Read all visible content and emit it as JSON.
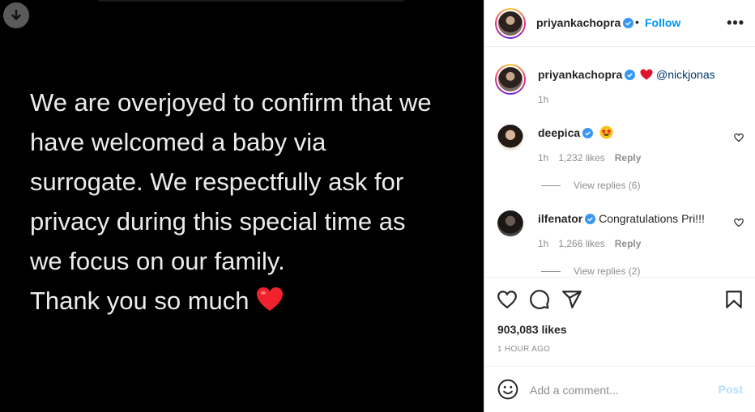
{
  "media": {
    "post_text": "We are overjoyed to confirm that we\nhave welcomed a baby via\nsurrogate. We respectfully ask for\nprivacy during this special time as\nwe focus on our family.\nThank you so much",
    "emoji_icon": "red-heart-emoji",
    "download_icon": "download-arrow-icon"
  },
  "header": {
    "username": "priyankachopra",
    "separator": "•",
    "follow_label": "Follow",
    "more_label": "•••"
  },
  "caption": {
    "username": "priyankachopra",
    "mention": "@nickjonas",
    "time": "1h"
  },
  "comments": [
    {
      "username": "deepica",
      "text": "",
      "emoji": "star-struck-emoji",
      "time": "1h",
      "likes": "1,232 likes",
      "reply": "Reply",
      "view_replies": "View replies (6)"
    },
    {
      "username": "ilfenator",
      "text": "Congratulations Pri!!!",
      "time": "1h",
      "likes": "1,266 likes",
      "reply": "Reply",
      "view_replies": "View replies (2)"
    }
  ],
  "actions": {
    "likes": "903,083 likes",
    "timestamp": "1 HOUR AGO"
  },
  "add_comment": {
    "placeholder": "Add a comment...",
    "post_label": "Post"
  },
  "colors": {
    "accent": "#0095f6",
    "verified": "#3897f0",
    "heart": "#ed4956",
    "muted": "#8e8e8e"
  }
}
